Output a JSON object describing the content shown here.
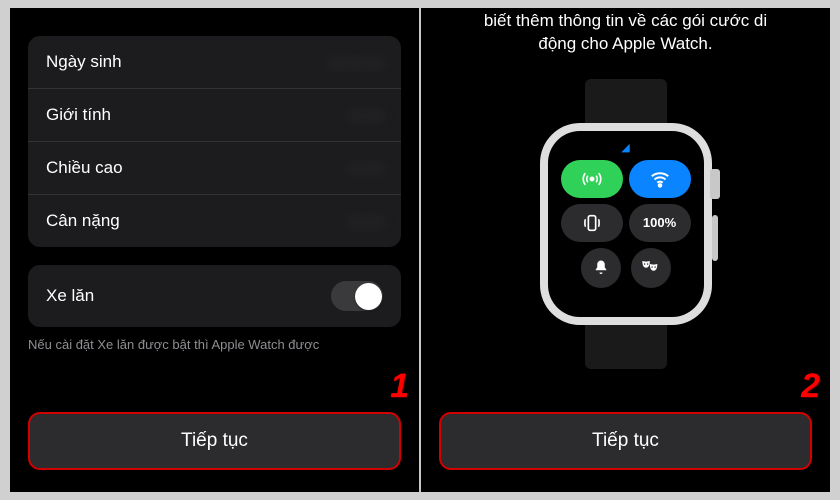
{
  "panel1": {
    "rows": [
      {
        "label": "Ngày sinh",
        "value": "— — —"
      },
      {
        "label": "Giới tính",
        "value": "— —"
      },
      {
        "label": "Chiều cao",
        "value": "— —"
      },
      {
        "label": "Cân nặng",
        "value": "— —"
      }
    ],
    "toggle_label": "Xe lăn",
    "helper": "Nếu cài đặt Xe lăn được bật thì Apple Watch được",
    "cta": "Tiếp tục",
    "step": "1"
  },
  "panel2": {
    "desc_line1": "biết thêm thông tin về các gói cước di",
    "desc_line2": "động cho Apple Watch.",
    "battery": "100%",
    "cta": "Tiếp tục",
    "step": "2"
  }
}
